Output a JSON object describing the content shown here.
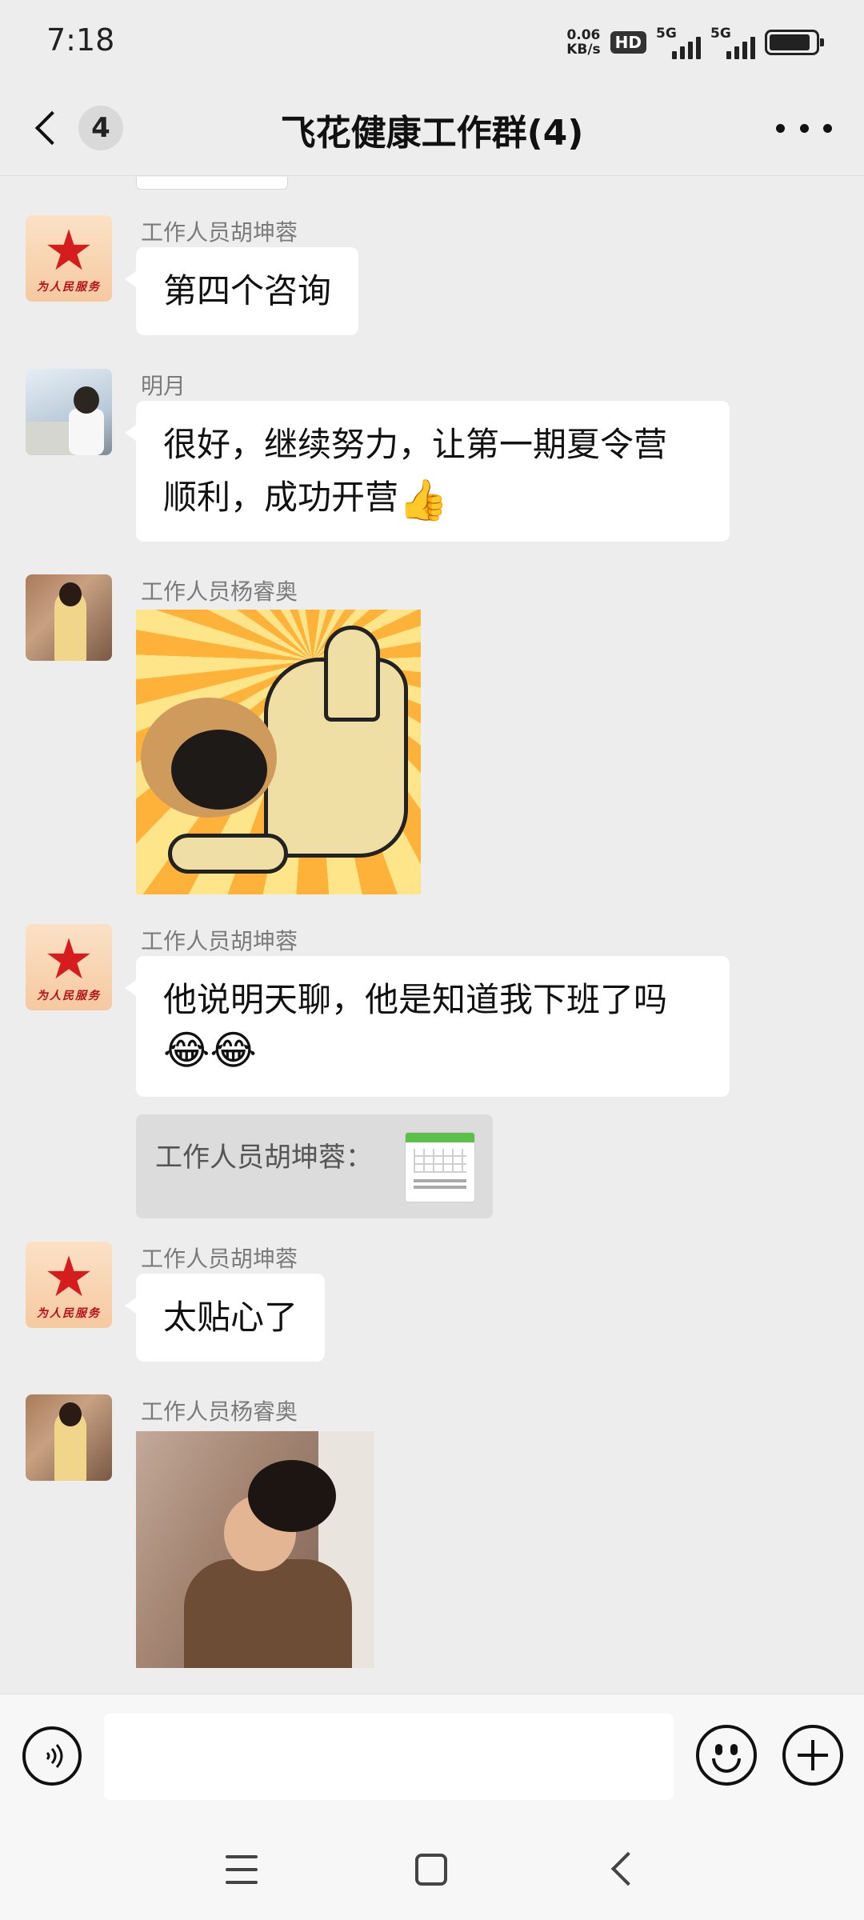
{
  "status_bar": {
    "time": "7:18",
    "net_speed_value": "0.06",
    "net_speed_unit": "KB/s",
    "hd_badge": "HD",
    "network_1": "5G",
    "network_2": "5G",
    "battery_percent": 90
  },
  "header": {
    "unread_count": "4",
    "title": "飞花健康工作群(4)"
  },
  "messages": [
    {
      "sender": "工作人员胡坤蓉",
      "avatar": "red-star-avatar",
      "type": "text",
      "text": "第四个咨询"
    },
    {
      "sender": "明月",
      "avatar": "office-photo-avatar",
      "type": "text",
      "text_line1": "很好，继续努力，让第一期夏令营",
      "text_line2": "顺利，成功开营",
      "emoji": "👍"
    },
    {
      "sender": "工作人员杨睿奥",
      "avatar": "girl-photo-avatar",
      "type": "sticker",
      "sticker": "doge-thumbs-up-sticker"
    },
    {
      "sender": "工作人员胡坤蓉",
      "avatar": "red-star-avatar",
      "type": "text",
      "text": "他说明天聊，他是知道我下班了吗",
      "emoji": "😂😂"
    },
    {
      "type": "quote",
      "quote_text": "工作人员胡坤蓉："
    },
    {
      "sender": "工作人员胡坤蓉",
      "avatar": "red-star-avatar",
      "type": "text",
      "text": "太贴心了"
    },
    {
      "sender": "工作人员杨睿奥",
      "avatar": "girl-photo-avatar",
      "type": "image",
      "image": "man-photo"
    }
  ],
  "avatar_motto": "为人民服务",
  "input_bar": {
    "placeholder": "",
    "icons": [
      "voice-icon",
      "emoji-icon",
      "plus-icon"
    ]
  },
  "nav_bar": {
    "icons": [
      "menu-icon",
      "home-icon",
      "back-icon"
    ]
  },
  "colors": {
    "background": "#ededed",
    "bubble": "#ffffff",
    "star_red": "#d61d1d"
  }
}
